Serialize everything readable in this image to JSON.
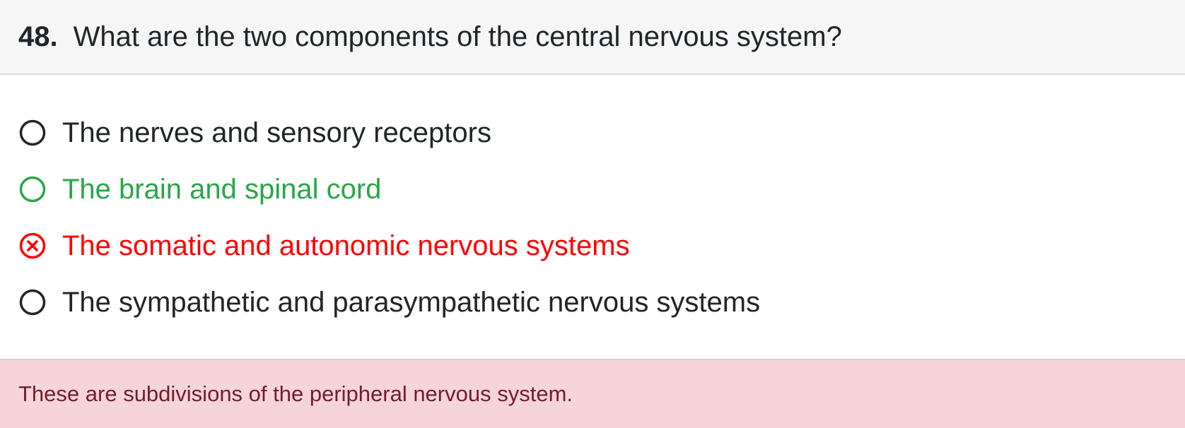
{
  "question": {
    "number": "48.",
    "text": "What are the two components of the central nervous system?"
  },
  "options": [
    {
      "label": "The nerves and sensory receptors",
      "state": "unselected",
      "color": "#212529"
    },
    {
      "label": "The brain and spinal cord",
      "state": "correct",
      "color": "#28a745"
    },
    {
      "label": "The somatic and autonomic nervous systems",
      "state": "selected-incorrect",
      "color": "#ff0000"
    },
    {
      "label": "The sympathetic and parasympathetic nervous systems",
      "state": "unselected",
      "color": "#212529"
    }
  ],
  "feedback": {
    "text": "These are subdivisions of the peripheral nervous system.",
    "background": "#f5d5da",
    "color": "#761b2c"
  },
  "icons": {
    "unselected": "radio-empty-icon",
    "correct": "radio-empty-icon",
    "selected-incorrect": "radio-x-icon"
  }
}
